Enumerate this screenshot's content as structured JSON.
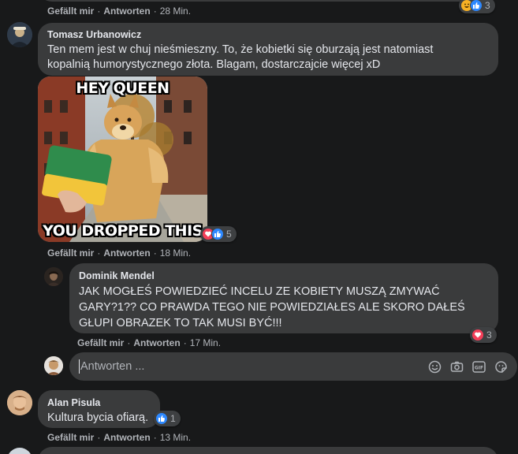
{
  "top_comment": {
    "actions": {
      "like": "Gefällt mir",
      "reply": "Antworten",
      "time": "28 Min."
    },
    "reaction_count": "3"
  },
  "comment_tomasz": {
    "author": "Tomasz Urbanowicz",
    "text_line1": "Ten mem jest w chuj nieśmieszny. To, że kobietki się oburzają jest natomiast",
    "text_line2": "kopalnią humorystycznego złota. Blagam, dostarczajcie więcej xD",
    "meme_top_text": "HEY QUEEN",
    "meme_bottom_text": "YOU DROPPED THIS",
    "reaction_count": "5",
    "actions": {
      "like": "Gefällt mir",
      "reply": "Antworten",
      "time": "18 Min."
    }
  },
  "reply_dominik": {
    "author": "Dominik Mendel",
    "text_line1": "JAK MOGŁEŚ POWIEDZIEĆ INCELU ZE KOBIETY MUSZĄ ZMYWAĆ",
    "text_line2": "GARY?1?? CO PRAWDA TEGO NIE POWIEDZIAŁES ALE SKORO DAŁEŚ",
    "text_line3": "GŁUPI OBRAZEK TO TAK MUSI BYĆ!!!",
    "reaction_count": "3",
    "actions": {
      "like": "Gefällt mir",
      "reply": "Antworten",
      "time": "17 Min."
    }
  },
  "reply_input": {
    "placeholder": "Antworten ..."
  },
  "comment_alan": {
    "author": "Alan Pisula",
    "text": "Kultura bycia ofiarą.",
    "reaction_count": "1",
    "actions": {
      "like": "Gefällt mir",
      "reply": "Antworten",
      "time": "13 Min."
    }
  },
  "colors": {
    "background": "#18191a",
    "bubble": "#3a3b3c",
    "text": "#e4e6eb",
    "secondary_text": "#b0b3b8",
    "like_blue": "#2d88ff",
    "love_red": "#f33e58",
    "haha_yellow": "#f7b125"
  }
}
